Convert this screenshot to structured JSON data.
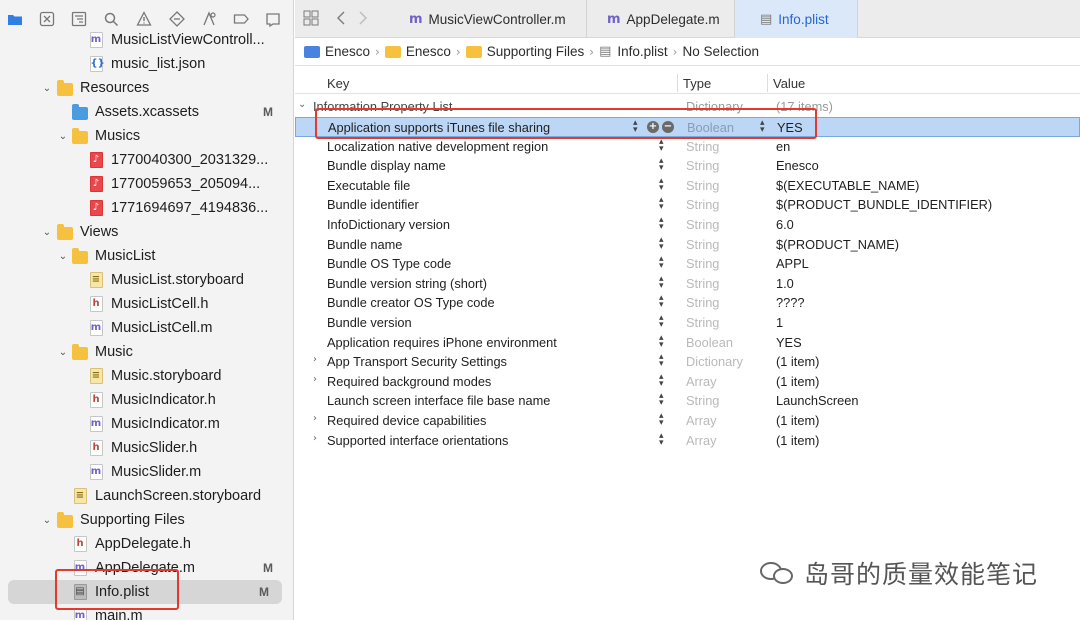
{
  "nav_toolbar": {
    "icons": [
      "folder-icon",
      "source-control-icon",
      "hierarchy-icon",
      "search-icon",
      "warning-icon",
      "test-icon",
      "debug-icon",
      "breakpoint-icon",
      "report-icon"
    ]
  },
  "navigator": {
    "items": [
      {
        "label": "MusicListViewControll...",
        "kind": "m",
        "badge": ""
      },
      {
        "label": "music_list.json",
        "kind": "json",
        "badge": ""
      },
      {
        "label": "Resources",
        "kind": "folder",
        "badge": ""
      },
      {
        "label": "Assets.xcassets",
        "kind": "assets",
        "badge": "M"
      },
      {
        "label": "Musics",
        "kind": "folder",
        "badge": ""
      },
      {
        "label": "1770040300_2031329...",
        "kind": "mp3",
        "badge": ""
      },
      {
        "label": "1770059653_205094...",
        "kind": "mp3",
        "badge": ""
      },
      {
        "label": "1771694697_4194836...",
        "kind": "mp3",
        "badge": ""
      },
      {
        "label": "Views",
        "kind": "folder",
        "badge": ""
      },
      {
        "label": "MusicList",
        "kind": "folder",
        "badge": ""
      },
      {
        "label": "MusicList.storyboard",
        "kind": "storyboard",
        "badge": ""
      },
      {
        "label": "MusicListCell.h",
        "kind": "h",
        "badge": ""
      },
      {
        "label": "MusicListCell.m",
        "kind": "m",
        "badge": ""
      },
      {
        "label": "Music",
        "kind": "folder",
        "badge": ""
      },
      {
        "label": "Music.storyboard",
        "kind": "storyboard",
        "badge": ""
      },
      {
        "label": "MusicIndicator.h",
        "kind": "h",
        "badge": ""
      },
      {
        "label": "MusicIndicator.m",
        "kind": "m",
        "badge": ""
      },
      {
        "label": "MusicSlider.h",
        "kind": "h",
        "badge": ""
      },
      {
        "label": "MusicSlider.m",
        "kind": "m",
        "badge": ""
      },
      {
        "label": "LaunchScreen.storyboard",
        "kind": "storyboard",
        "badge": ""
      },
      {
        "label": "Supporting Files",
        "kind": "folder",
        "badge": ""
      },
      {
        "label": "AppDelegate.h",
        "kind": "h",
        "badge": ""
      },
      {
        "label": "AppDelegate.m",
        "kind": "m",
        "badge": "M"
      },
      {
        "label": "Info.plist",
        "kind": "plist",
        "badge": "M"
      },
      {
        "label": "main.m",
        "kind": "m",
        "badge": ""
      }
    ]
  },
  "tabs": [
    {
      "label": "MusicViewController.m",
      "icon": "m"
    },
    {
      "label": "AppDelegate.m",
      "icon": "m"
    },
    {
      "label": "Info.plist",
      "icon": "plist"
    }
  ],
  "jumpbar": {
    "project": "Enesco",
    "group": "Enesco",
    "subgroup": "Supporting Files",
    "file": "Info.plist",
    "selection": "No Selection"
  },
  "plist": {
    "headers": {
      "key": "Key",
      "type": "Type",
      "value": "Value"
    },
    "root": {
      "key": "Information Property List",
      "type": "Dictionary",
      "value": "(17 items)"
    },
    "rows": [
      {
        "key": "Application supports iTunes file sharing",
        "type": "Boolean",
        "value": "YES",
        "expandable": false
      },
      {
        "key": "Localization native development region",
        "type": "String",
        "value": "en",
        "expandable": false
      },
      {
        "key": "Bundle display name",
        "type": "String",
        "value": "Enesco",
        "expandable": false
      },
      {
        "key": "Executable file",
        "type": "String",
        "value": "$(EXECUTABLE_NAME)",
        "expandable": false
      },
      {
        "key": "Bundle identifier",
        "type": "String",
        "value": "$(PRODUCT_BUNDLE_IDENTIFIER)",
        "expandable": false
      },
      {
        "key": "InfoDictionary version",
        "type": "String",
        "value": "6.0",
        "expandable": false
      },
      {
        "key": "Bundle name",
        "type": "String",
        "value": "$(PRODUCT_NAME)",
        "expandable": false
      },
      {
        "key": "Bundle OS Type code",
        "type": "String",
        "value": "APPL",
        "expandable": false
      },
      {
        "key": "Bundle version string (short)",
        "type": "String",
        "value": "1.0",
        "expandable": false
      },
      {
        "key": "Bundle creator OS Type code",
        "type": "String",
        "value": "????",
        "expandable": false
      },
      {
        "key": "Bundle version",
        "type": "String",
        "value": "1",
        "expandable": false
      },
      {
        "key": "Application requires iPhone environment",
        "type": "Boolean",
        "value": "YES",
        "expandable": false
      },
      {
        "key": "App Transport Security Settings",
        "type": "Dictionary",
        "value": "(1 item)",
        "expandable": true
      },
      {
        "key": "Required background modes",
        "type": "Array",
        "value": "(1 item)",
        "expandable": true
      },
      {
        "key": "Launch screen interface file base name",
        "type": "String",
        "value": "LaunchScreen",
        "expandable": false
      },
      {
        "key": "Required device capabilities",
        "type": "Array",
        "value": "(1 item)",
        "expandable": true
      },
      {
        "key": "Supported interface orientations",
        "type": "Array",
        "value": "(1 item)",
        "expandable": true
      }
    ]
  },
  "watermark": "岛哥的质量效能笔记",
  "colors": {
    "accent": "#2566d4",
    "selection": "#bcd6f5",
    "annotation": "#e33a2e",
    "folder": "#f6c13f"
  }
}
